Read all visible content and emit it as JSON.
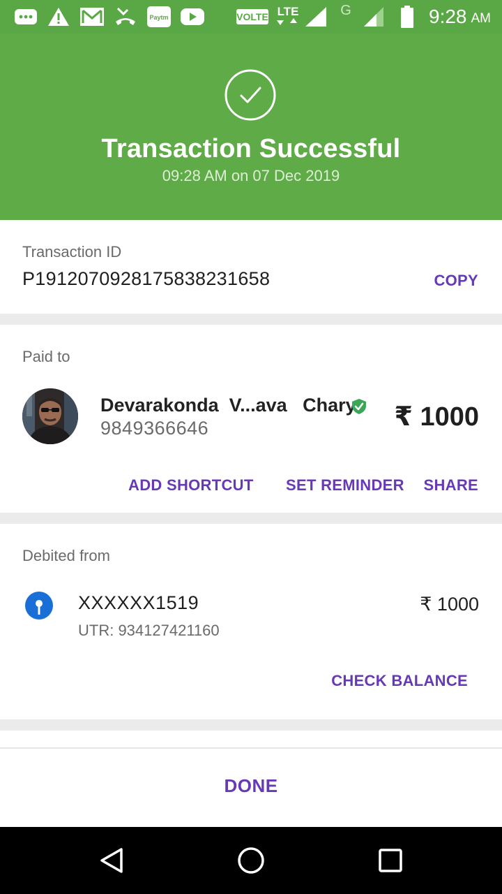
{
  "status_bar": {
    "icons": [
      "messages-icon",
      "warning-icon",
      "gmail-icon",
      "missed-call-icon",
      "paytm-icon",
      "youtube-icon",
      "volte-icon",
      "lte-icon",
      "signal-icon",
      "g-network-icon",
      "signal-icon",
      "battery-icon"
    ],
    "volte_label": "VOLTE",
    "lte_label": "LTE",
    "g_label": "G",
    "paytm_label": "Paytm",
    "time": "9:28",
    "ampm": "AM"
  },
  "header": {
    "title": "Transaction Successful",
    "subtitle": "09:28 AM on 07 Dec 2019",
    "color": "#5fab47"
  },
  "transaction": {
    "label": "Transaction ID",
    "id": "P1912070928175838231658",
    "copy_label": "COPY"
  },
  "paid_to": {
    "label": "Paid to",
    "name": "Devarakonda  V...ava   Chary",
    "phone": "9849366646",
    "amount": "₹ 1000",
    "actions": {
      "add_shortcut": "ADD SHORTCUT",
      "set_reminder": "SET REMINDER",
      "share": "SHARE"
    }
  },
  "debited_from": {
    "label": "Debited from",
    "account": "XXXXXX1519",
    "utr": "UTR: 934127421160",
    "amount": "₹ 1000",
    "check_balance": "CHECK BALANCE"
  },
  "footer": {
    "done_label": "DONE"
  },
  "colors": {
    "accent": "#6739b7",
    "success_green": "#5fab47",
    "verified_green": "#3aa757",
    "bank_blue": "#1a6fd6"
  }
}
